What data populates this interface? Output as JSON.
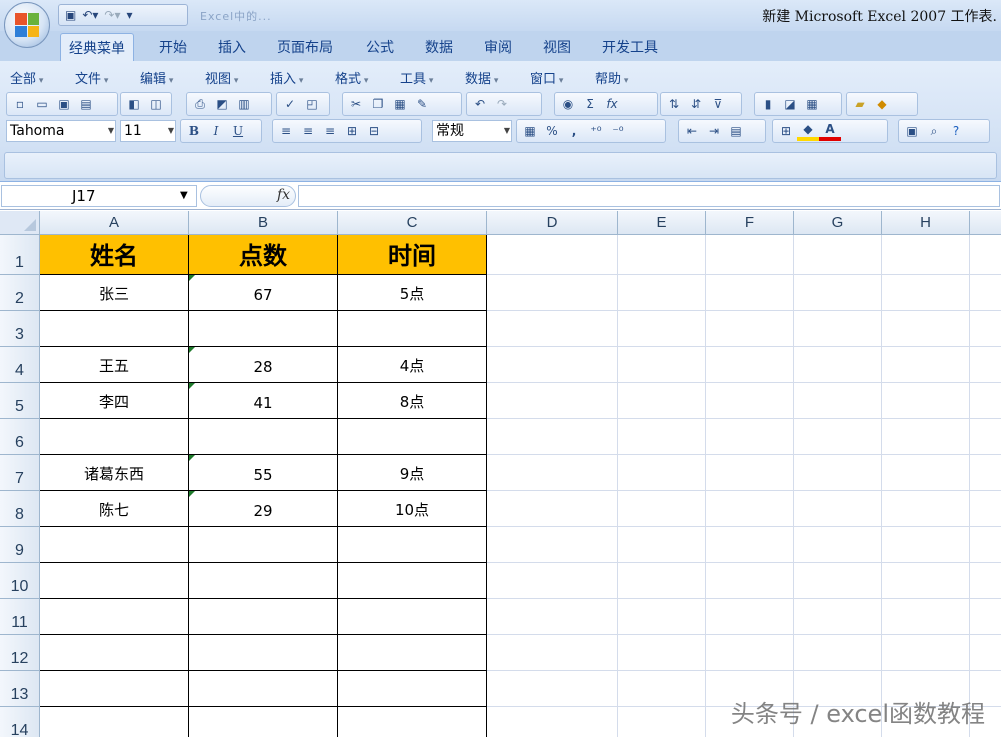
{
  "title_bar": {
    "window_title": "新建 Microsoft Excel 2007 工作表.",
    "faded_title": "Excel中的..."
  },
  "ribbon_tabs": [
    "经典菜单",
    "开始",
    "插入",
    "页面布局",
    "公式",
    "数据",
    "审阅",
    "视图",
    "开发工具"
  ],
  "classic_menu": [
    "全部",
    "文件",
    "编辑",
    "视图",
    "插入",
    "格式",
    "工具",
    "数据",
    "窗口",
    "帮助"
  ],
  "toolbar": {
    "font_name": "Tahoma",
    "font_size": "11",
    "number_format": "常规",
    "bold": "B",
    "italic": "I",
    "underline": "U",
    "percent": "%",
    "comma": ",",
    "sum": "Σ",
    "fx": "fx"
  },
  "formula_bar": {
    "name_box": "J17",
    "fx_label": "fx",
    "formula": ""
  },
  "columns": [
    "A",
    "B",
    "C",
    "D",
    "E",
    "F",
    "G",
    "H"
  ],
  "rows": [
    "1",
    "2",
    "3",
    "4",
    "5",
    "6",
    "7",
    "8",
    "9",
    "10",
    "11",
    "12",
    "13",
    "14"
  ],
  "table": {
    "headers": [
      "姓名",
      "点数",
      "时间"
    ],
    "rows": [
      [
        "张三",
        "67",
        "5点"
      ],
      [
        "",
        "",
        ""
      ],
      [
        "王五",
        "28",
        "4点"
      ],
      [
        "李四",
        "41",
        "8点"
      ],
      [
        "",
        "",
        ""
      ],
      [
        "诸葛东西",
        "55",
        "9点"
      ],
      [
        "陈七",
        "29",
        "10点"
      ],
      [
        "",
        "",
        ""
      ],
      [
        "",
        "",
        ""
      ],
      [
        "",
        "",
        ""
      ],
      [
        "",
        "",
        ""
      ],
      [
        "",
        "",
        ""
      ],
      [
        "",
        "",
        ""
      ]
    ]
  },
  "colors": {
    "header_fill": "#ffc000",
    "ribbon": "#d2e1f4",
    "text_marker": "#1e7a2b"
  },
  "watermark": "头条号 / excel函数教程"
}
